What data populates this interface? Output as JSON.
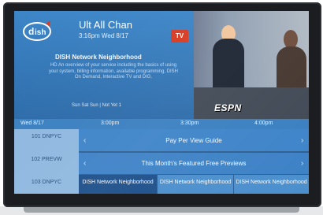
{
  "channel": {
    "name": "Ult All Chan",
    "time": "3:16pm Wed 8/17"
  },
  "rating": "TV",
  "program": {
    "title": "DISH Network Neighborhood",
    "description": "HD An overview of your service including the basics of using your system, billing information, available programming, DISH On Demand, Interactive TV and DIG.",
    "schedule_line": "Sun Sat Sun | Not Yet 1"
  },
  "pip": {
    "network_label": "ESPN"
  },
  "guide": {
    "date": "Wed 8/17",
    "times": [
      "3:00pm",
      "3:30pm",
      "4:00pm"
    ],
    "rows": [
      {
        "channel_label": "101 DNPYC",
        "program": "Pay Per View Guide"
      },
      {
        "channel_label": "102 PREVW",
        "program": "This Month's Featured Free Previews"
      },
      {
        "channel_label": "103 DNPYC",
        "cells": [
          "DISH Network Neighborhood",
          "DISH Network Neighborhood",
          "DISH Network Neighborhood"
        ]
      }
    ]
  },
  "colors": {
    "screen": "#2e6fb3",
    "info_panel_top": "#3d86c8",
    "guide_header": "#3a7fc0",
    "selected_cell": "#1d4f8a",
    "rating_badge": "#d83a23"
  }
}
